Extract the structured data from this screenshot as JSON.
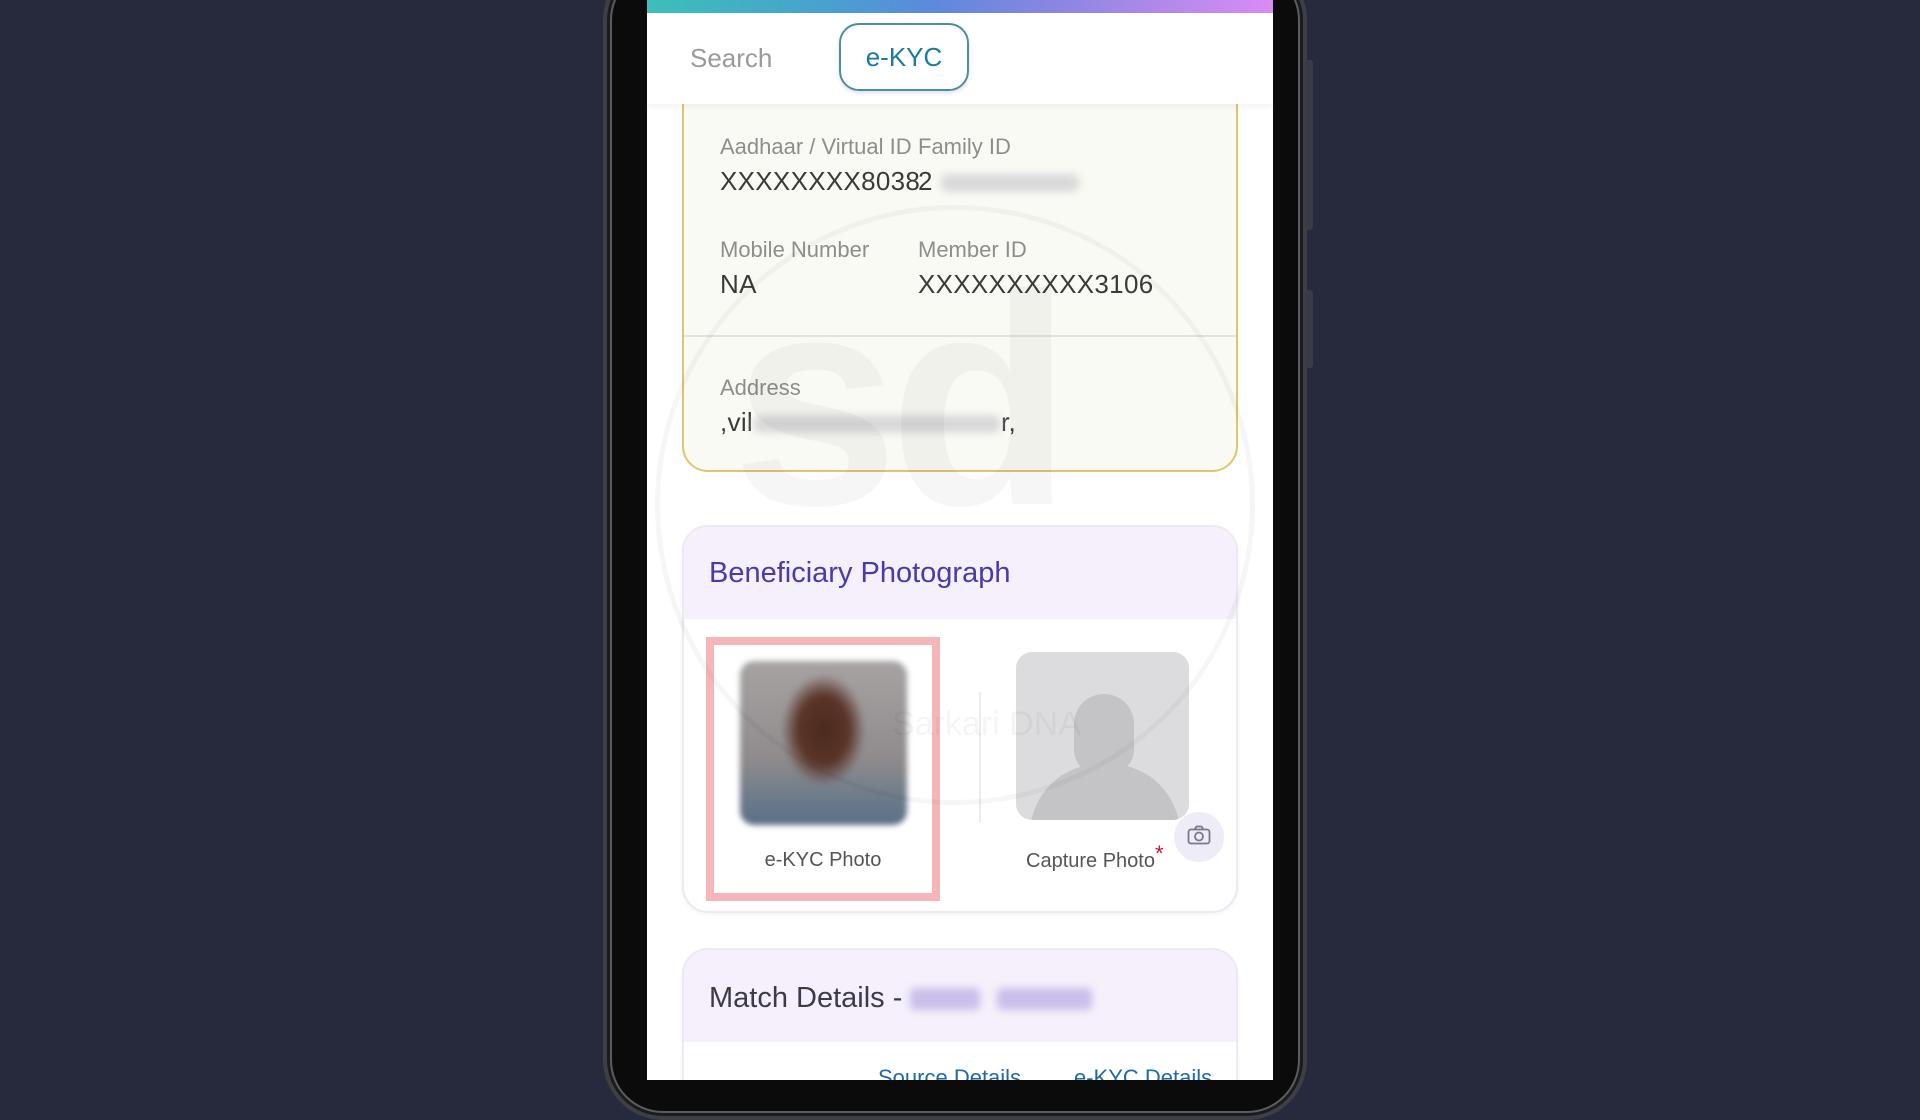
{
  "header": {
    "tabs": [
      {
        "label": "Search",
        "active": false
      },
      {
        "label": "e-KYC",
        "active": true
      }
    ]
  },
  "info_card": {
    "aadhaar": {
      "label": "Aadhaar / Virtual ID",
      "value": "XXXXXXXX8038"
    },
    "family": {
      "label": "Family ID",
      "value_visible_prefix": "2"
    },
    "mobile": {
      "label": "Mobile Number",
      "value": "NA"
    },
    "member": {
      "label": "Member ID",
      "value": "XXXXXXXXXX3106"
    },
    "address": {
      "label": "Address",
      "value_visible_prefix": ",vil",
      "value_visible_suffix": "r,"
    }
  },
  "beneficiary": {
    "title": "Beneficiary Photograph",
    "ekyc_photo_label": "e-KYC Photo",
    "capture_photo_label": "Capture Photo",
    "required_marker": "*",
    "camera_icon": "camera-icon"
  },
  "match_details": {
    "title_prefix": "Match Details - ",
    "links": [
      "Source Details",
      "e-KYC Details"
    ]
  },
  "watermark": {
    "letters": "sd",
    "text": "Sarkari DNA"
  },
  "colors": {
    "accent_tab": "#1d7aa0",
    "card_border_gold": "#e1c46c",
    "section_title_purple": "#4b3aa8",
    "highlight_box": "#f6b6b9",
    "link_blue": "#1e6aa8",
    "required_red": "#c0182a"
  }
}
